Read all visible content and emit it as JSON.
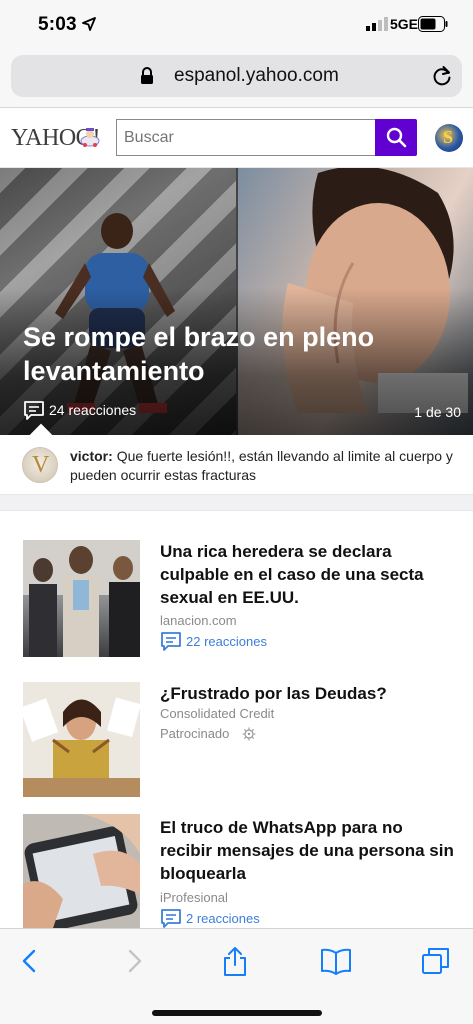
{
  "status": {
    "time": "5:03",
    "network": "5GE"
  },
  "browser": {
    "url": "espanol.yahoo.com"
  },
  "header": {
    "logo": "YAHOO!",
    "search_placeholder": "Buscar",
    "avatar_letter": "S"
  },
  "hero": {
    "title": "Se rompe el brazo en pleno levantamiento",
    "reactions": "24 reacciones",
    "pager": "1 de 30"
  },
  "comment": {
    "author": "victor:",
    "text": "Que fuerte lesión!!, están llevando al limite al cuerpo y pueden ocurrir estas fracturas",
    "avatar_letter": "V"
  },
  "feed": [
    {
      "title": "Una rica heredera se declara culpable en el caso de una secta sexual en EE.UU.",
      "source": "lanacion.com",
      "reactions": "22 reacciones"
    },
    {
      "title": "¿Frustrado por las Deudas?",
      "source": "Consolidated Credit",
      "sponsored": "Patrocinado"
    },
    {
      "title": "El truco de WhatsApp para no recibir mensajes de una persona sin bloquearla",
      "source": "iProfesional",
      "reactions": "2 reacciones"
    }
  ],
  "colors": {
    "yahoo_purple": "#6001d2",
    "ios_blue": "#147efb",
    "link_blue": "#3c7fd8"
  }
}
